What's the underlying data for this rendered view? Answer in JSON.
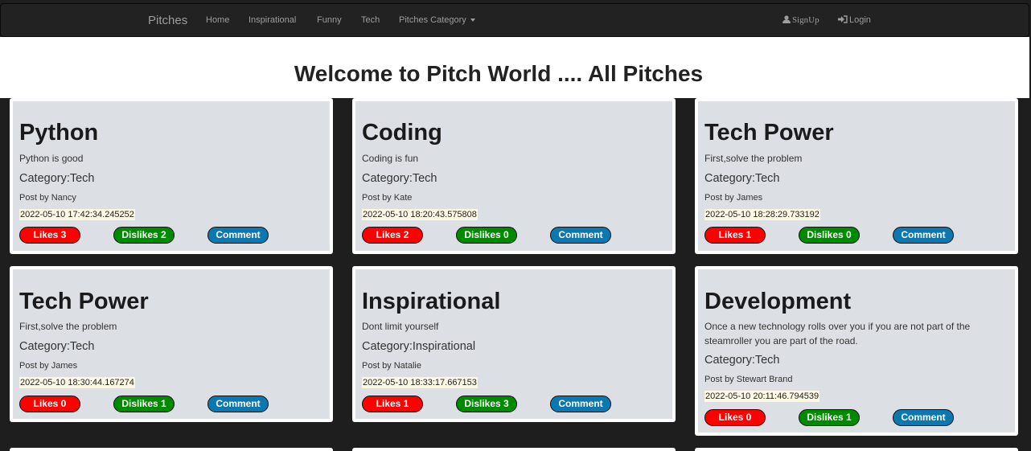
{
  "navbar": {
    "brand": "Pitches",
    "links": [
      "Home",
      "Inspirational",
      "Funny",
      "Tech"
    ],
    "dropdown_label": "Pitches Category",
    "signup": "SignUp",
    "login": "Login"
  },
  "page_title": "Welcome to Pitch World .... All Pitches",
  "colors": {
    "like": "#ff0000",
    "dislike": "#008a00",
    "comment": "#0d78b0"
  },
  "pitches": [
    {
      "title": "Python",
      "description": "Python is good",
      "category": "Category:Tech",
      "author": "Post by Nancy",
      "date": "2022-05-10 17:42:34.245252",
      "likes": "Likes 3",
      "dislikes": "Dislikes 2",
      "comment": "Comment"
    },
    {
      "title": "Coding",
      "description": "Coding is fun",
      "category": "Category:Tech",
      "author": "Post by Kate",
      "date": "2022-05-10 18:20:43.575808",
      "likes": "Likes 2",
      "dislikes": "Dislikes 0",
      "comment": "Comment"
    },
    {
      "title": "Tech Power",
      "description": "First,solve the problem",
      "category": "Category:Tech",
      "author": "Post by James",
      "date": "2022-05-10 18:28:29.733192",
      "likes": "Likes 1",
      "dislikes": "Dislikes 0",
      "comment": "Comment"
    },
    {
      "title": "Tech Power",
      "description": "First,solve the problem",
      "category": "Category:Tech",
      "author": "Post by James",
      "date": "2022-05-10 18:30:44.167274",
      "likes": "Likes 0",
      "dislikes": "Dislikes 1",
      "comment": "Comment"
    },
    {
      "title": "Inspirational",
      "description": "Dont limit yourself",
      "category": "Category:Inspirational",
      "author": "Post by Natalie",
      "date": "2022-05-10 18:33:17.667153",
      "likes": "Likes 1",
      "dislikes": "Dislikes 3",
      "comment": "Comment"
    },
    {
      "title": "Development",
      "description": "Once a new technology rolls over you if you are not part of the steamroller you are part of the road.",
      "category": "Category:Tech",
      "author": "Post by Stewart Brand",
      "date": "2022-05-10 20:11:46.794539",
      "likes": "Likes 0",
      "dislikes": "Dislikes 1",
      "comment": "Comment"
    }
  ]
}
